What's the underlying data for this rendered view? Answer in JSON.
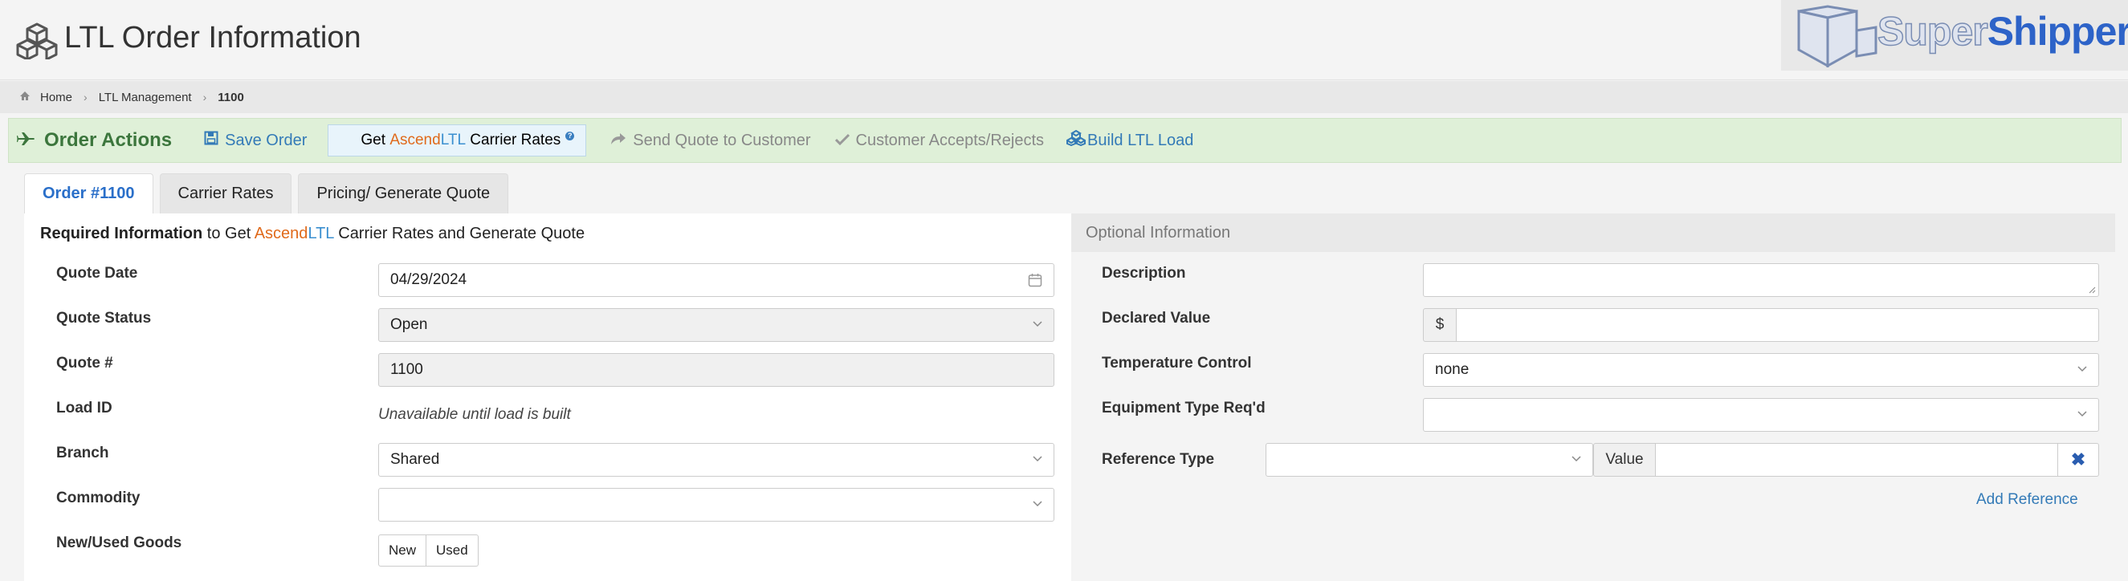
{
  "header": {
    "title": "LTL Order Information"
  },
  "logo": {
    "part1": "Super",
    "part2": "Shippers"
  },
  "breadcrumb": {
    "home": "Home",
    "section": "LTL Management",
    "current": "1100"
  },
  "actions": {
    "title": "Order Actions",
    "save": "Save Order",
    "get_prefix": "Get ",
    "ascend": "Ascend",
    "ltl": "LTL",
    "get_suffix": " Carrier Rates",
    "help": "?",
    "send_quote": "Send Quote to Customer",
    "customer_accepts": "Customer Accepts/Rejects",
    "build_load": "Build LTL Load"
  },
  "tabs": [
    "Order #1100",
    "Carrier Rates",
    "Pricing/ Generate Quote"
  ],
  "required": {
    "title_bold": "Required Information",
    "title_mid": " to Get ",
    "ascend": "Ascend",
    "ltl": "LTL",
    "title_end": " Carrier Rates and Generate Quote",
    "quote_date_label": "Quote Date",
    "quote_date_value": "04/29/2024",
    "quote_status_label": "Quote Status",
    "quote_status_value": "Open",
    "quote_num_label": "Quote #",
    "quote_num_value": "1100",
    "load_id_label": "Load ID",
    "load_id_value": "Unavailable until load is built",
    "branch_label": "Branch",
    "branch_value": "Shared",
    "commodity_label": "Commodity",
    "commodity_value": "",
    "new_used_label": "New/Used Goods",
    "new_btn": "New",
    "used_btn": "Used"
  },
  "optional": {
    "title": "Optional Information",
    "description_label": "Description",
    "declared_value_label": "Declared Value",
    "currency": "$",
    "temperature_label": "Temperature Control",
    "temperature_value": "none",
    "equipment_label": "Equipment Type Req'd",
    "reference_type_label": "Reference Type",
    "value_label": "Value",
    "add_reference": "Add Reference"
  }
}
